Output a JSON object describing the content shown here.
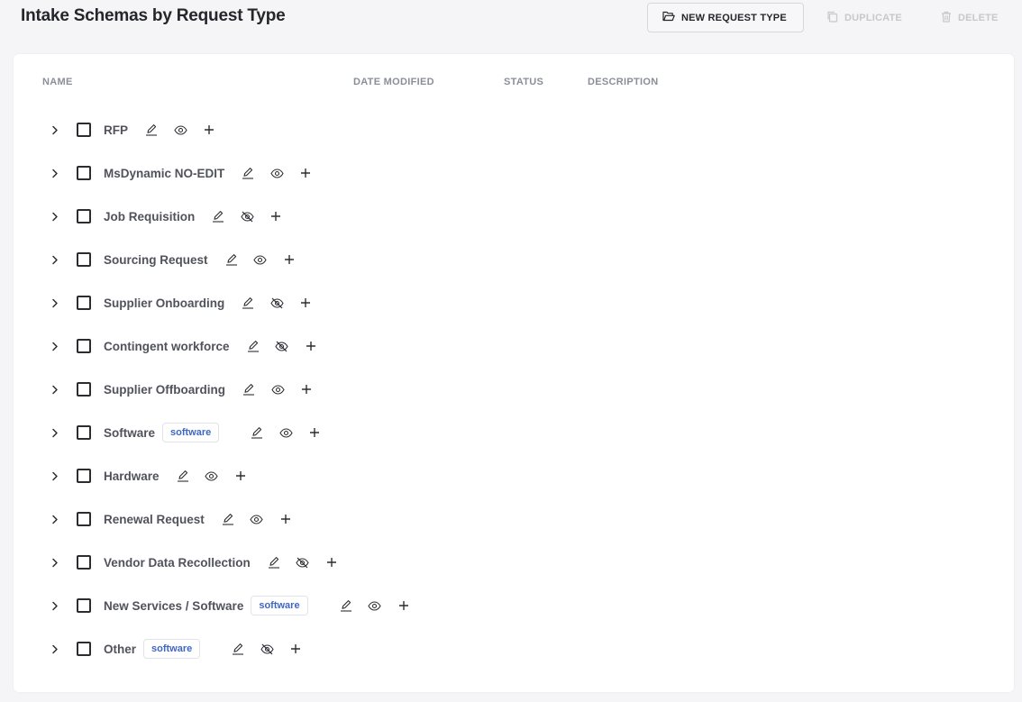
{
  "header": {
    "title": "Intake Schemas by Request Type",
    "new_label": "NEW REQUEST TYPE",
    "duplicate_label": "DUPLICATE",
    "delete_label": "DELETE"
  },
  "table": {
    "columns": [
      "NAME",
      "DATE MODIFIED",
      "STATUS",
      "DESCRIPTION"
    ],
    "rows": [
      {
        "name": "RFP",
        "tag": "",
        "visible": true
      },
      {
        "name": "MsDynamic NO-EDIT",
        "tag": "",
        "visible": true
      },
      {
        "name": "Job Requisition",
        "tag": "",
        "visible": false
      },
      {
        "name": "Sourcing Request",
        "tag": "",
        "visible": true
      },
      {
        "name": "Supplier Onboarding",
        "tag": "",
        "visible": false
      },
      {
        "name": "Contingent workforce",
        "tag": "",
        "visible": false
      },
      {
        "name": "Supplier Offboarding",
        "tag": "",
        "visible": true
      },
      {
        "name": "Software",
        "tag": "software",
        "visible": true
      },
      {
        "name": "Hardware",
        "tag": "",
        "visible": true
      },
      {
        "name": "Renewal Request",
        "tag": "",
        "visible": true
      },
      {
        "name": "Vendor Data Recollection",
        "tag": "",
        "visible": false
      },
      {
        "name": "New Services / Software",
        "tag": "software",
        "visible": true
      },
      {
        "name": "Other",
        "tag": "software",
        "visible": false
      }
    ]
  },
  "icons": {
    "new": "folder-open-icon",
    "duplicate": "copy-icon",
    "delete": "trash-icon",
    "expand": "chevron-right-icon",
    "edit": "pencil-icon",
    "visible": "eye-icon",
    "hidden": "eye-off-icon",
    "add": "plus-icon"
  },
  "colors": {
    "tag_text": "#3e66c9",
    "disabled": "#c6c8cd"
  }
}
